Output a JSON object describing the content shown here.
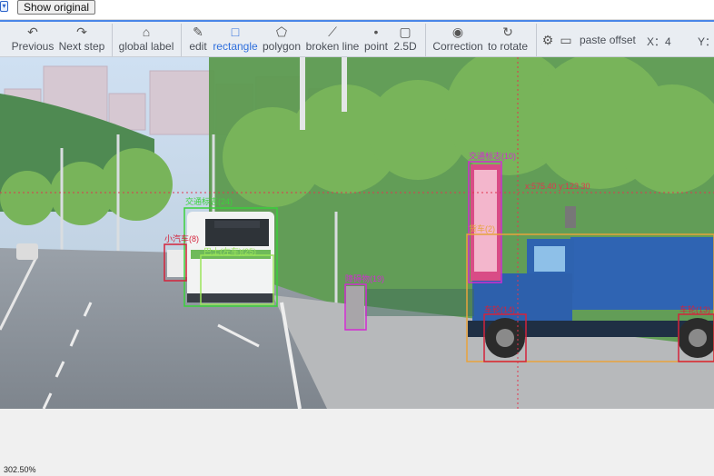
{
  "topbar": {
    "show_original": "Show original"
  },
  "toolbar": {
    "previous": "Previous",
    "next_step": "Next step",
    "global_label": "global label",
    "edit": "edit",
    "rectangle": "rectangle",
    "polygon": "polygon",
    "broken_line": "broken line",
    "point": "point",
    "two_five_d": "2.5D",
    "correction": "Correction",
    "to_rotate": "to rotate",
    "paste_offset": "paste offset",
    "x_label": "X：4",
    "y_label": "Y："
  },
  "annotations": {
    "bus_front": "交通标志(24)",
    "small_car": "小汽车(8)",
    "bus": "巴士(左车)(25)",
    "obstacle": "障碍物(19)",
    "sign_pole": "交通标志(10)",
    "truck_text": "货车(2)",
    "wheel_left": "车轮(14)",
    "wheel_right": "车轮(13)",
    "cursor_coords": "x:575.40 y:123.30"
  },
  "status": {
    "zoom": "302.50%"
  },
  "colors": {
    "toolbar_bg": "#e9edf2",
    "accent": "#2f6fdc",
    "green_box": "#3bd23b",
    "magenta_box": "#d22bd2",
    "red_box": "#d4233b",
    "orange_box": "#e8a33c"
  }
}
